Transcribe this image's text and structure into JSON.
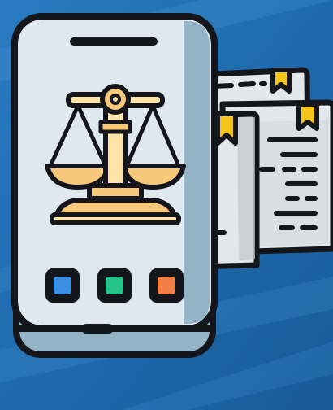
{
  "illustration": {
    "subject": "phone-with-justice-scale-and-documents",
    "icons": [
      "justice-scale-icon",
      "document-icon",
      "bookmark-icon"
    ],
    "app_icon_colors": [
      "#3b8ee0",
      "#25c28a",
      "#ef7f45"
    ]
  },
  "colors": {
    "background": "#1f6aad",
    "background_highlight": "#3e8fcf",
    "outline": "#14161c",
    "phone_body": "#93b4c6",
    "phone_screen": "#dfe8ee",
    "scale_gold": "#f7c77a",
    "scale_light": "#fde3a8",
    "paper": "#e3e6ea",
    "paper_shadow": "#c3c8cd",
    "bookmark": "#f5c518"
  }
}
